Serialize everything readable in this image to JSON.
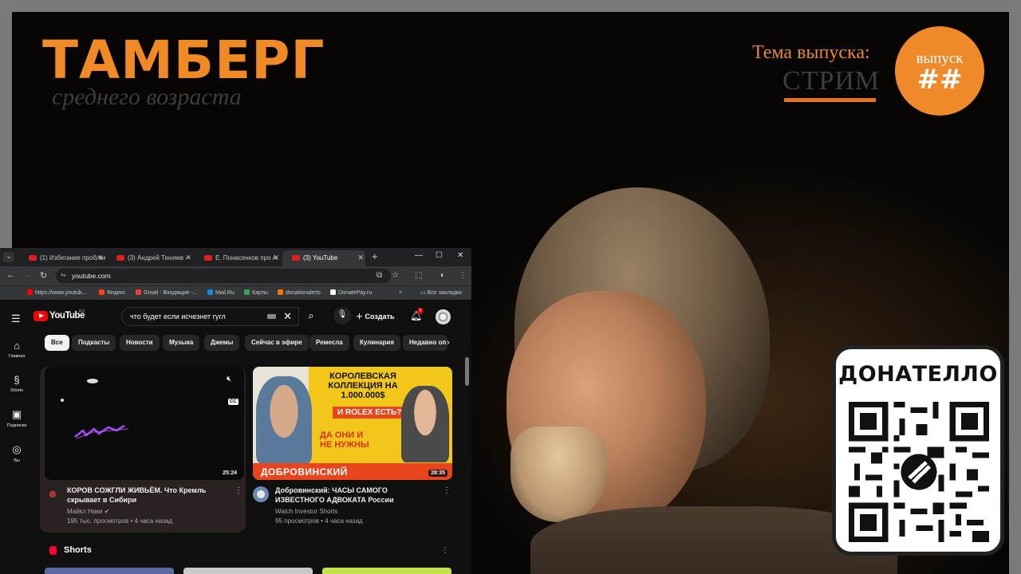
{
  "overlay": {
    "brand_title": "ТАМБЕРГ",
    "brand_subtitle": "среднего возраста",
    "topic_label": "Тема выпуска:",
    "topic_value": "СТРИМ",
    "episode_label": "выпуск",
    "episode_number": "##",
    "donate_title": "ДОНАТЕЛЛО",
    "accent_color": "#f08a24"
  },
  "browser": {
    "tabs": [
      {
        "label": "(1) Избегание проблем",
        "active": false
      },
      {
        "label": "(3) Андрей Тюняев -",
        "active": false
      },
      {
        "label": "Е. Понасенков про А",
        "active": false
      },
      {
        "label": "(3) YouTube",
        "active": true
      }
    ],
    "url": "youtube.com",
    "bookmarks": [
      {
        "label": "https://www.youtub...",
        "color": "#ff0000"
      },
      {
        "label": "Яндекс",
        "color": "#fc3f1d"
      },
      {
        "label": "Gmail - Входящие -...",
        "color": "#ea4335"
      },
      {
        "label": "Mail.Ru",
        "color": "#168de2"
      },
      {
        "label": "Карты",
        "color": "#34a853"
      },
      {
        "label": "donationalerts",
        "color": "#f57507"
      },
      {
        "label": "DonatePay.ru",
        "color": "#ffffff"
      }
    ],
    "bookmarks_all": "Все закладки"
  },
  "youtube": {
    "logo_text": "YouTube",
    "region": "RU",
    "search_value": "что будет если исчезнет гугл",
    "create_label": "Создать",
    "notifications_count": "9",
    "sidebar": [
      {
        "label": "Главная",
        "icon": "home-icon"
      },
      {
        "label": "Shorts",
        "icon": "shorts-icon"
      },
      {
        "label": "Подписки",
        "icon": "subscriptions-icon"
      },
      {
        "label": "Вы",
        "icon": "you-icon"
      }
    ],
    "chips": [
      "Все",
      "Подкасты",
      "Новости",
      "Музыка",
      "Джемы",
      "Сейчас в эфире",
      "Ремесла",
      "Кулинария",
      "Недавно оп"
    ],
    "videos": [
      {
        "title": "КОРОВ СОЖГЛИ ЖИВЬЁМ. Что Кремль скрывает в Сибири",
        "channel": "Майкл Наки",
        "meta": "195 тыс. просмотров • 4 часа назад",
        "duration": "25:24"
      },
      {
        "title": "Добровинский: ЧАСЫ САМОГО ИЗВЕСТНОГО АДВОКАТА России",
        "channel": "Watch Investor Shorts",
        "meta": "95 просмотров • 4 часа назад",
        "duration": "28:35",
        "thumb_banner": "КОРОЛЕВСКАЯ КОЛЛЕКЦИЯ НА 1.000.000$",
        "thumb_question": "И ROLEX ЕСТЬ?",
        "thumb_answer": "ДА ОНИ И НЕ НУЖНЫ",
        "thumb_name": "ДОБРОВИНСКИЙ"
      }
    ],
    "shorts_heading": "Shorts"
  }
}
